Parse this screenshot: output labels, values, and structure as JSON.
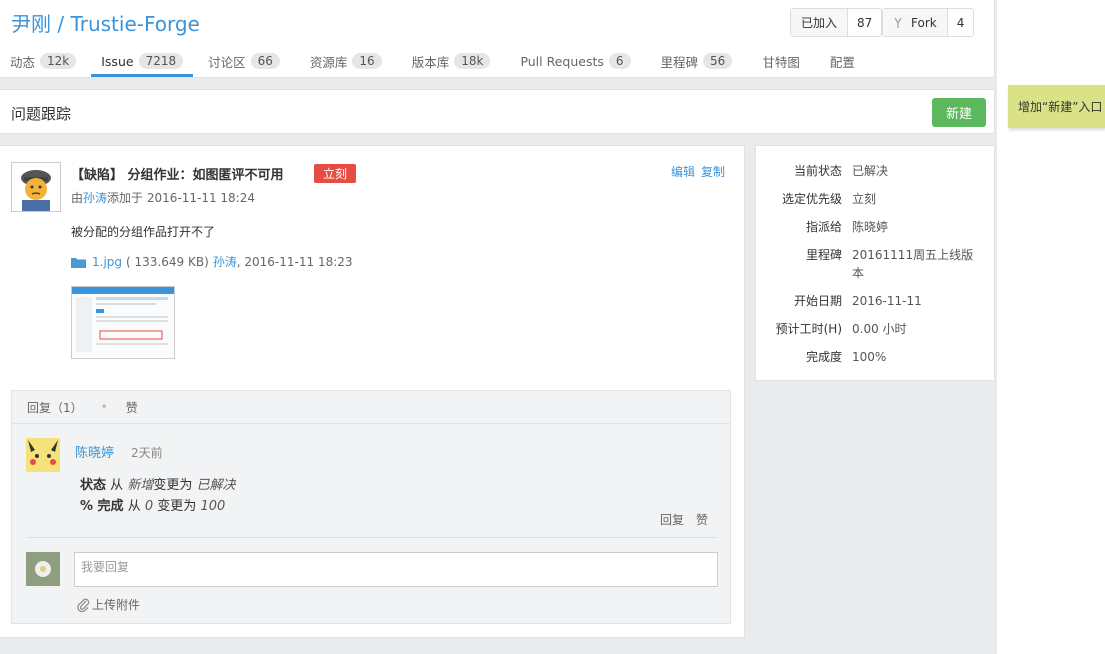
{
  "header": {
    "title": "尹刚 / Trustie-Forge",
    "joined_label": "已加入",
    "joined_count": "87",
    "fork_label": "Fork",
    "fork_count": "4"
  },
  "tabs": [
    {
      "label": "动态",
      "count": "12k"
    },
    {
      "label": "Issue",
      "count": "7218",
      "active": true
    },
    {
      "label": "讨论区",
      "count": "66"
    },
    {
      "label": "资源库",
      "count": "16"
    },
    {
      "label": "版本库",
      "count": "18k"
    },
    {
      "label": "Pull Requests",
      "count": "6"
    },
    {
      "label": "里程碑",
      "count": "56"
    },
    {
      "label": "甘特图",
      "count": ""
    },
    {
      "label": "配置",
      "count": ""
    }
  ],
  "tracker": {
    "title": "问题跟踪",
    "new_button": "新建"
  },
  "sticky_note": "增加“新建”入口",
  "issue": {
    "title": "【缺陷】 分组作业：如图匿评不可用",
    "priority_badge": "立刻",
    "edit": "编辑",
    "copy": "复制",
    "meta_prefix": "由",
    "author": "孙涛",
    "meta_suffix": "添加于 2016-11-11 18:24",
    "description": "被分配的分组作品打开不了",
    "attachment": {
      "name": "1.jpg",
      "size": "( 133.649 KB)",
      "uploader": "孙涛",
      "time": ", 2016-11-11 18:23"
    }
  },
  "replies_bar": {
    "reply_label": "回复（1）",
    "like_label": "赞"
  },
  "reply": {
    "name": "陈晓婷",
    "time": "2天前",
    "change1": {
      "field": "状态",
      "from_word": "从",
      "from": "新增",
      "to_word": "变更为",
      "to": "已解决"
    },
    "change2": {
      "field": "% 完成",
      "from_word": "从",
      "from": "0",
      "to_word": "变更为",
      "to": "100"
    },
    "reply_action": "回复",
    "like_action": "赞"
  },
  "composer": {
    "placeholder": "我要回复",
    "upload_label": "上传附件"
  },
  "attributes": [
    {
      "key": "当前状态",
      "value": "已解决"
    },
    {
      "key": "选定优先级",
      "value": "立刻"
    },
    {
      "key": "指派给",
      "value": "陈晓婷",
      "link": true
    },
    {
      "key": "里程碑",
      "value": "20161111周五上线版本"
    },
    {
      "key": "开始日期",
      "value": "2016-11-11"
    },
    {
      "key": "预计工时(H)",
      "value": "0.00 小时"
    },
    {
      "key": "完成度",
      "value": "100%"
    }
  ]
}
